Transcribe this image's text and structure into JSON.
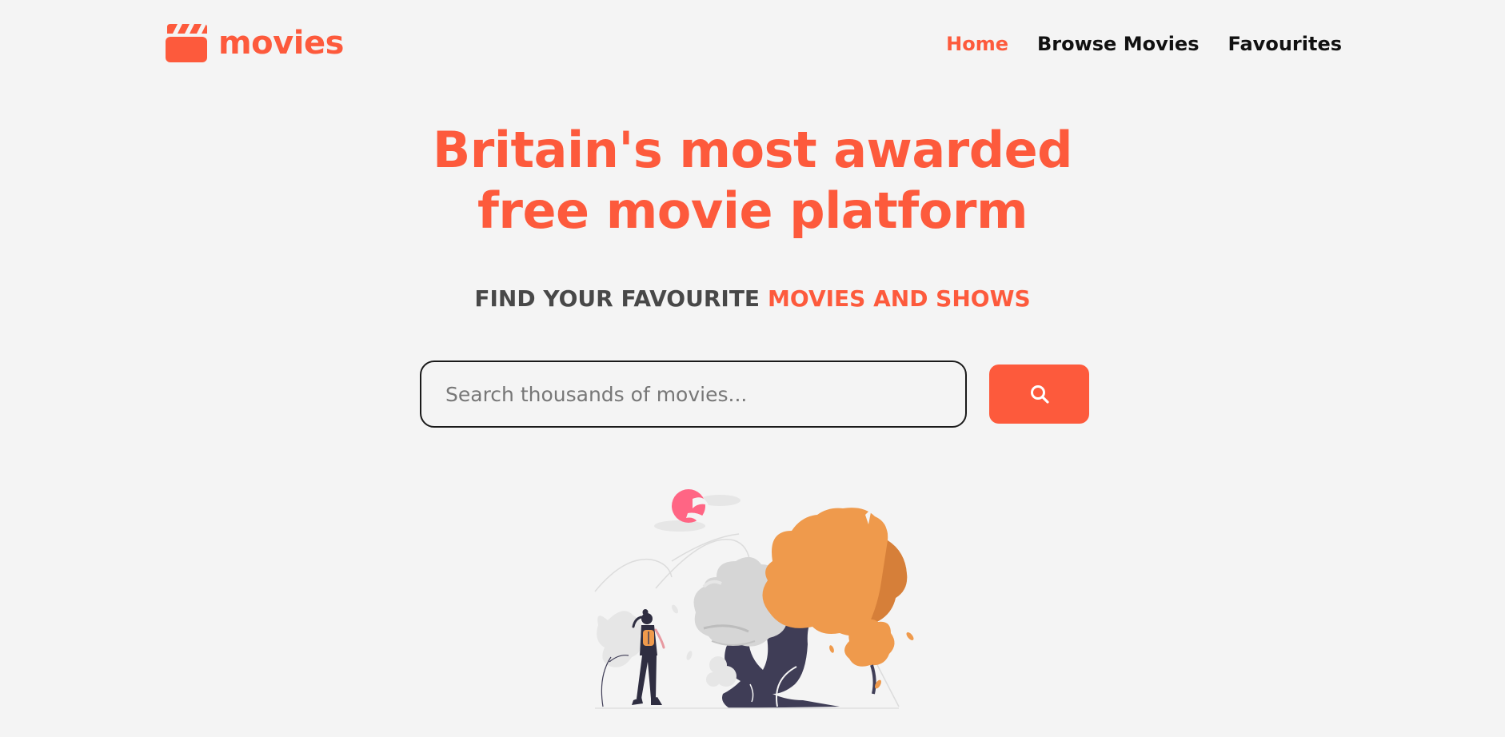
{
  "brand": {
    "name": "movies",
    "icon": "clapperboard-icon",
    "accent_color": "#fd5a3c"
  },
  "nav": {
    "items": [
      {
        "label": "Home",
        "active": true
      },
      {
        "label": "Browse Movies",
        "active": false
      },
      {
        "label": "Favourites",
        "active": false
      }
    ]
  },
  "hero": {
    "headline_line1": "Britain's most awarded",
    "headline_line2": "free movie platform",
    "subline_dark": "FIND YOUR FAVOURITE",
    "subline_accent": "MOVIES AND SHOWS"
  },
  "search": {
    "placeholder": "Search thousands of movies...",
    "value": "",
    "button_icon": "search-icon"
  },
  "illustration": {
    "subject": "hiker-with-trees-illustration",
    "colors": {
      "tree_orange": "#ef9a4c",
      "trunk_dark": "#3f3d56",
      "sun_pink": "#ff6584",
      "cloud_gray": "#e6e6e6"
    }
  }
}
